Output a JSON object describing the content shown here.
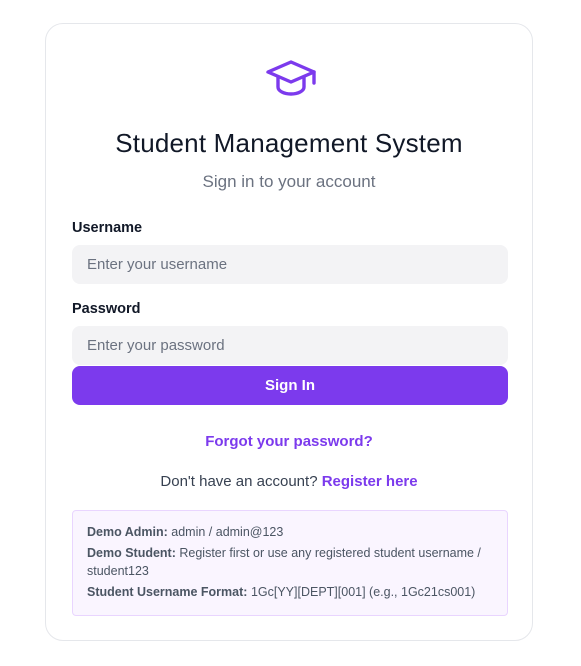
{
  "app": {
    "title": "Student Management System",
    "subtitle": "Sign in to your account",
    "logo_icon": "graduation-cap-icon",
    "accent_color": "#7c3aed"
  },
  "form": {
    "username_label": "Username",
    "username_placeholder": "Enter your username",
    "username_value": "",
    "password_label": "Password",
    "password_placeholder": "Enter your password",
    "password_value": "",
    "signin_label": "Sign In"
  },
  "links": {
    "forgot_password": "Forgot your password?",
    "no_account_text": "Don't have an account?",
    "register_here": "Register here"
  },
  "demo": {
    "admin_label": "Demo Admin:",
    "admin_value": "admin / admin@123",
    "student_label": "Demo Student:",
    "student_value": "Register first or use any registered student username / student123",
    "format_label": "Student Username Format:",
    "format_value": "1Gc[YY][DEPT][001] (e.g., 1Gc21cs001)"
  }
}
